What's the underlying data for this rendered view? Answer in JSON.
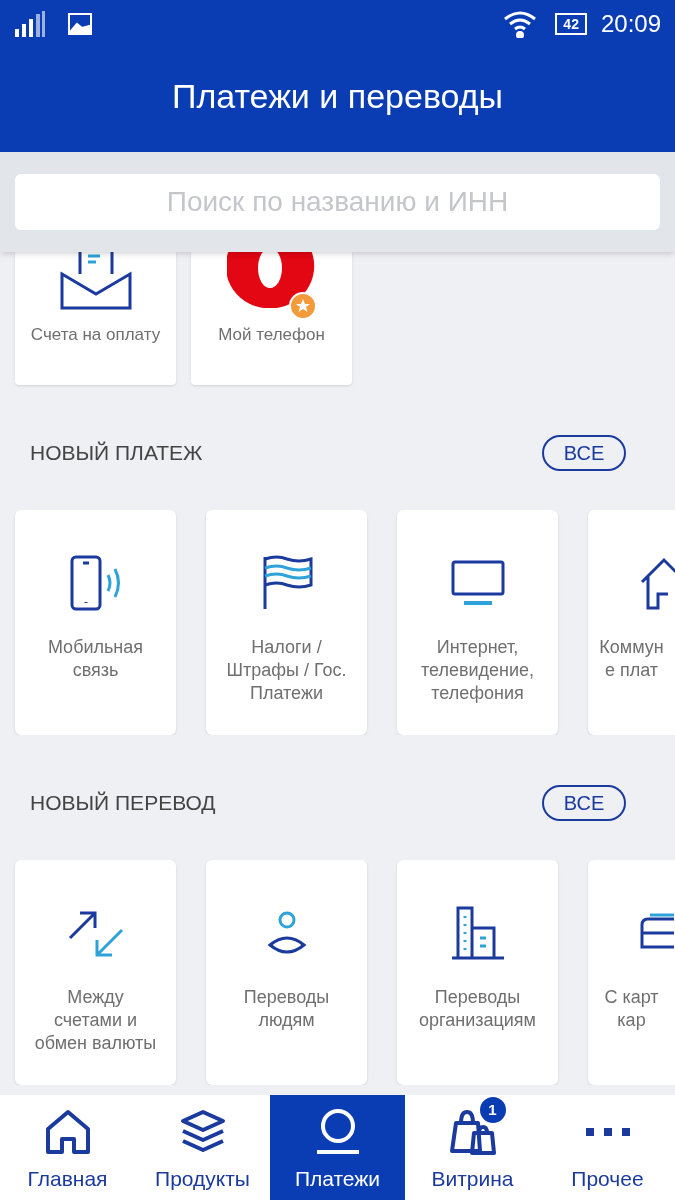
{
  "status_bar": {
    "battery": "42",
    "time": "20:09"
  },
  "header": {
    "title": "Платежи и переводы"
  },
  "search": {
    "placeholder": "Поиск по названию и ИНН"
  },
  "favorites": [
    {
      "kind": "invoice",
      "label": "Счета на оплату",
      "starred": false
    },
    {
      "kind": "operator",
      "label": "Мой телефон",
      "starred": true
    }
  ],
  "sections": [
    {
      "title": "НОВЫЙ ПЛАТЕЖ",
      "all_button": "ВСЕ",
      "items": [
        {
          "kind": "mobile",
          "lines": [
            "Мобильная",
            "связь"
          ]
        },
        {
          "kind": "flag",
          "lines": [
            "Налоги /",
            "Штрафы / Гос.",
            "Платежи"
          ]
        },
        {
          "kind": "tv",
          "lines": [
            "Интернет,",
            "телевидение,",
            "телефония"
          ]
        },
        {
          "kind": "house",
          "lines": [
            "Коммун",
            "е плат"
          ]
        }
      ]
    },
    {
      "title": "НОВЫЙ ПЕРЕВОД",
      "all_button": "ВСЕ",
      "items": [
        {
          "kind": "exchange",
          "lines": [
            "Между",
            "счетами и",
            "обмен валюты"
          ]
        },
        {
          "kind": "person",
          "lines": [
            "Переводы",
            "людям"
          ]
        },
        {
          "kind": "building",
          "lines": [
            "Переводы",
            "организациям"
          ]
        },
        {
          "kind": "card",
          "lines": [
            "С карт",
            "кар"
          ]
        }
      ]
    }
  ],
  "nav": [
    {
      "kind": "home",
      "label": "Главная",
      "selected": false
    },
    {
      "kind": "layers",
      "label": "Продукты",
      "selected": false
    },
    {
      "kind": "payments",
      "label": "Платежи",
      "selected": true
    },
    {
      "kind": "bags",
      "label": "Витрина",
      "selected": false,
      "badge": "1"
    },
    {
      "kind": "more",
      "label": "Прочее",
      "selected": false
    }
  ]
}
